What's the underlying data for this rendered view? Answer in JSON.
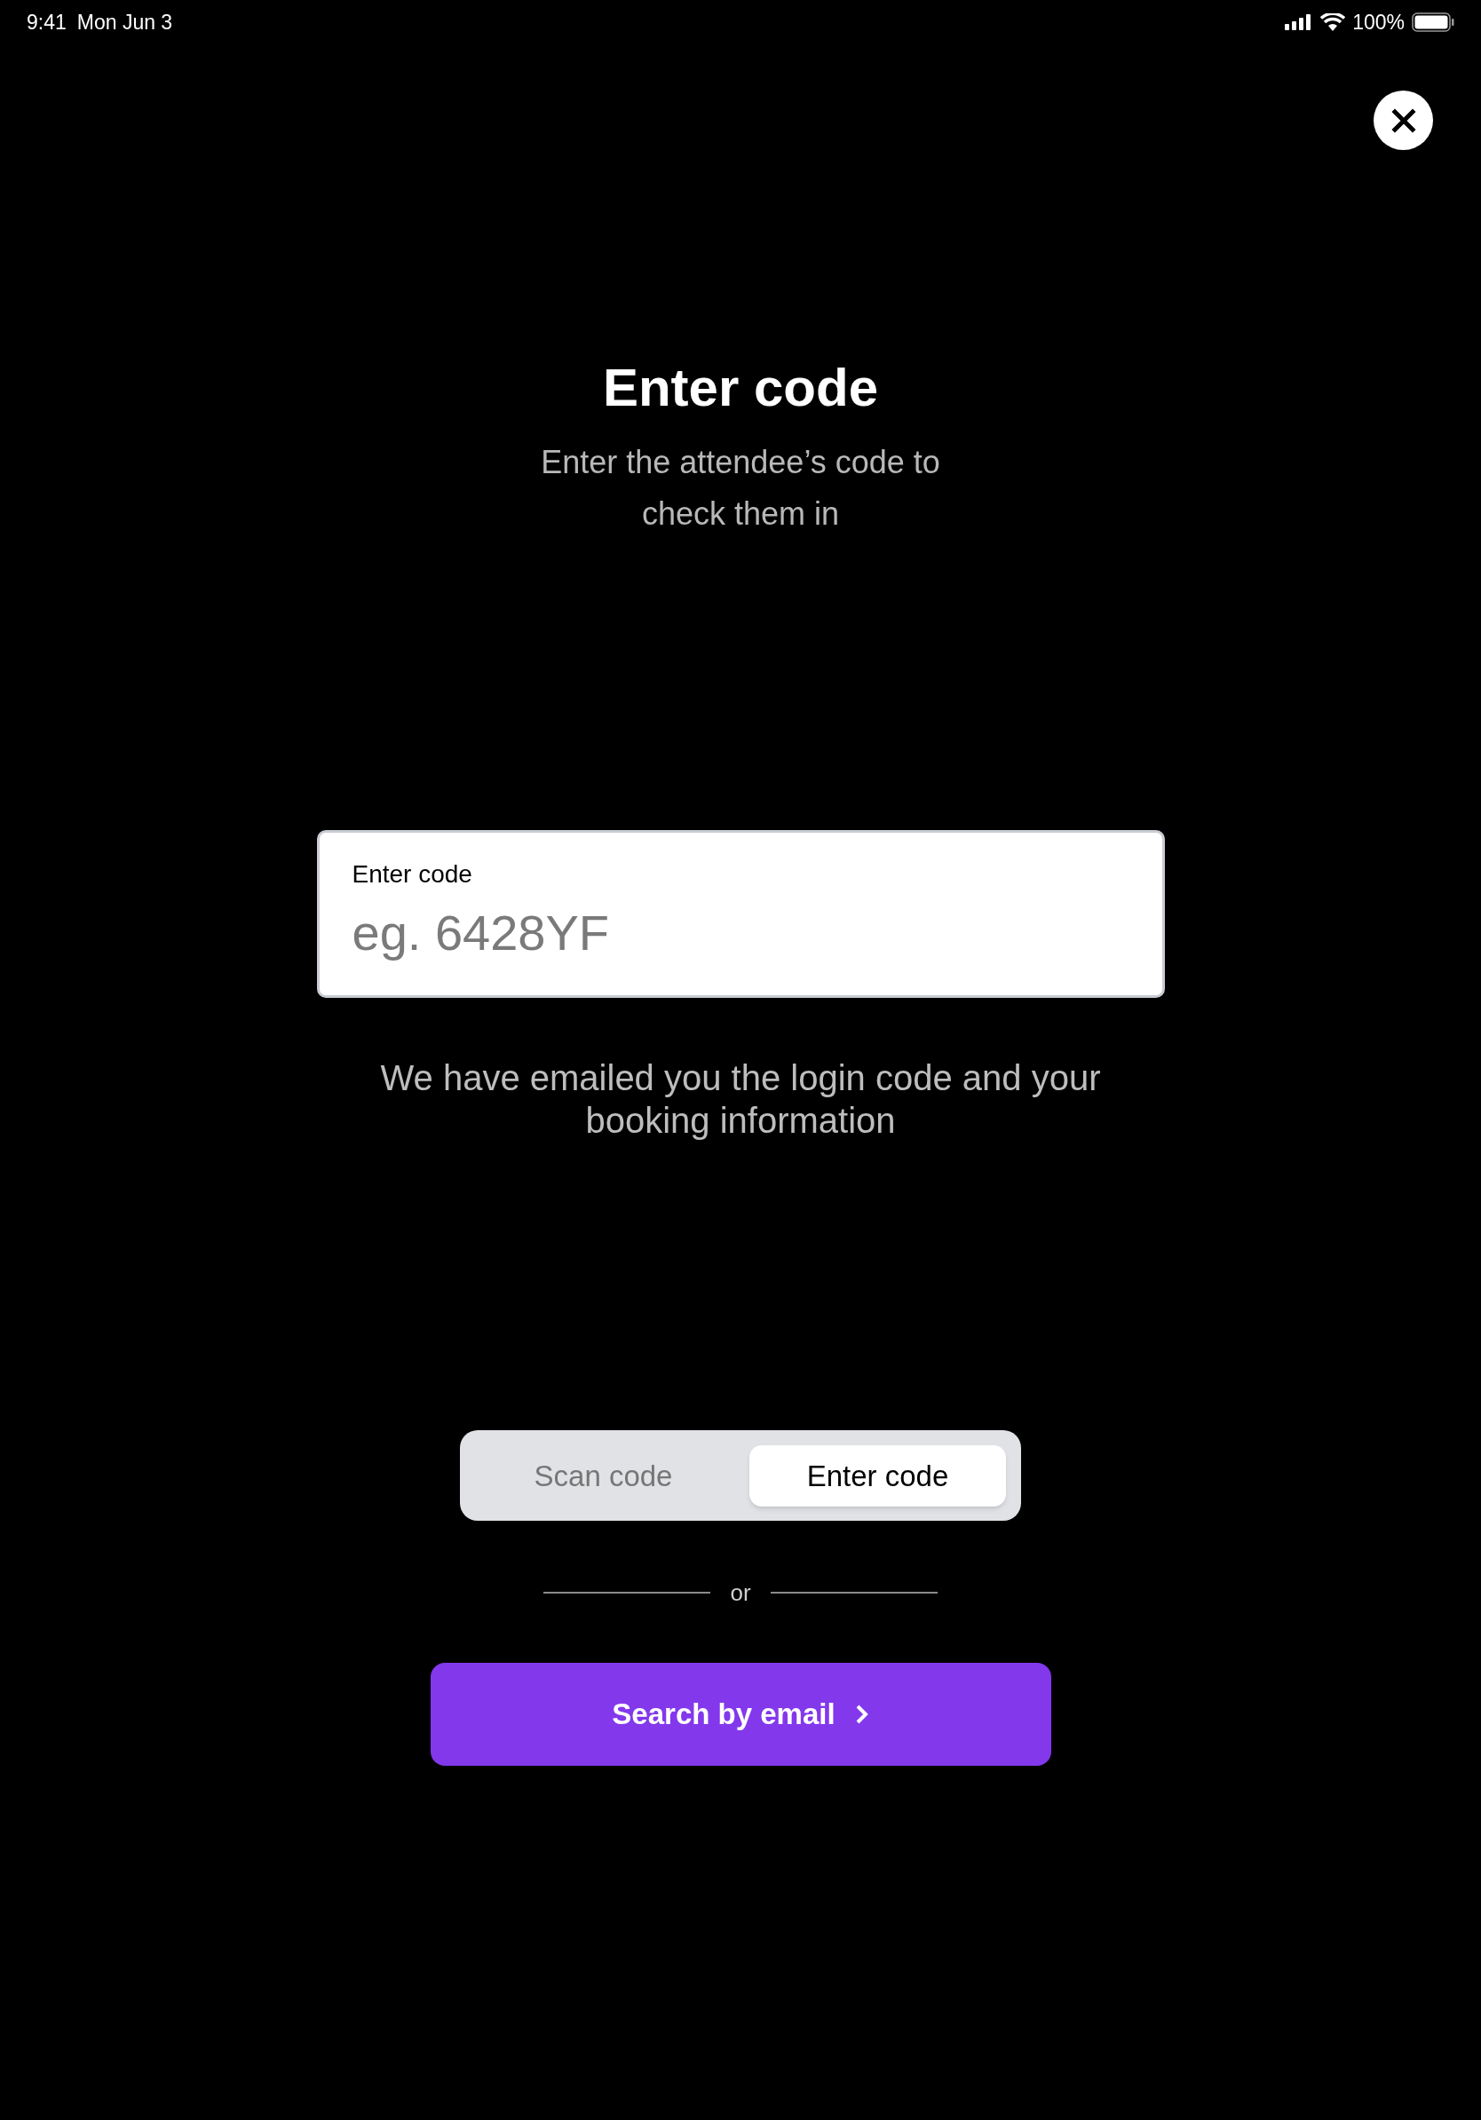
{
  "status_bar": {
    "time": "9:41",
    "date": "Mon Jun 3",
    "battery": "100%"
  },
  "title": "Enter code",
  "subtitle": "Enter the attendee’s code to check them in",
  "code_field": {
    "label": "Enter code",
    "placeholder": "eg. 6428YF"
  },
  "helper_text": "We have emailed you the login code and your booking information",
  "mode_tabs": [
    {
      "label": "Scan code",
      "selected": false
    },
    {
      "label": "Enter code",
      "selected": true
    }
  ],
  "divider": "or",
  "search_button": "Search by email"
}
